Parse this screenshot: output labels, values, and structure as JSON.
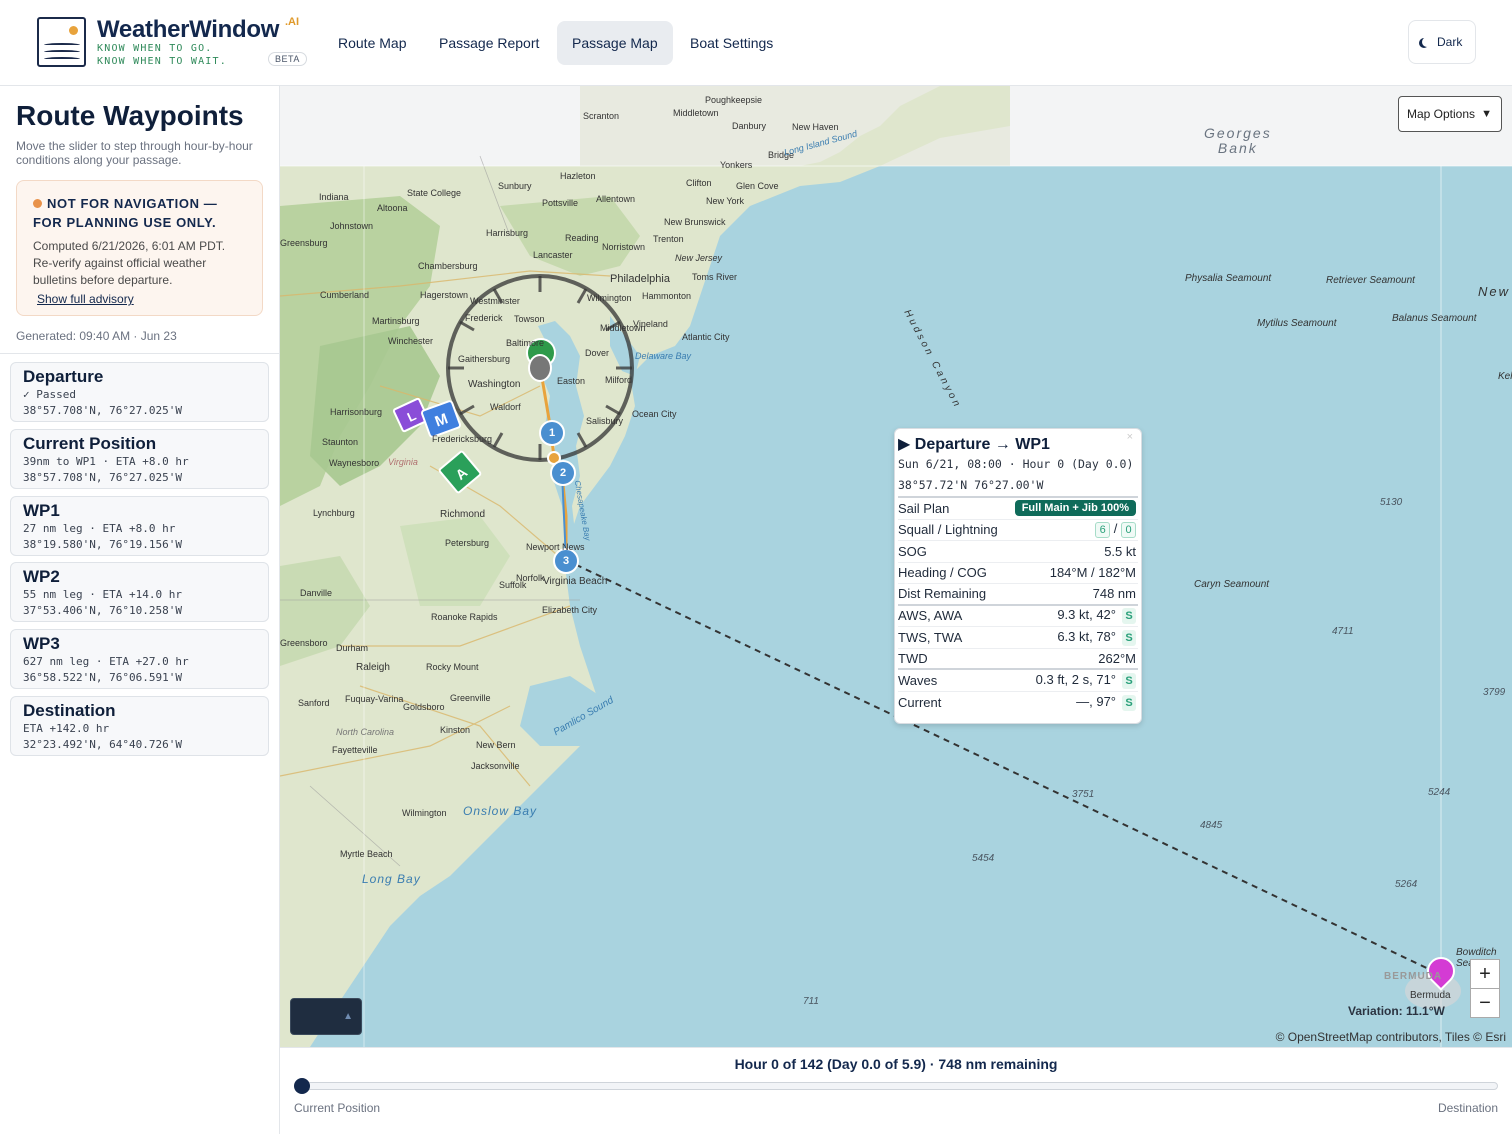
{
  "app": {
    "brand": "WeatherWindow",
    "brand_suffix": ".AI",
    "tagline_1": "KNOW WHEN TO GO.",
    "tagline_2": "KNOW WHEN TO WAIT.",
    "beta": "BETA"
  },
  "nav": {
    "items": [
      "Route Map",
      "Passage Report",
      "Passage Map",
      "Boat Settings"
    ],
    "active": "Passage Map",
    "theme_button": "Dark"
  },
  "sidebar": {
    "title": "Route Waypoints",
    "subtitle": "Move the slider to step through hour-by-hour conditions along your passage.",
    "advisory": {
      "heading_1": "NOT FOR NAVIGATION —",
      "heading_2": "FOR PLANNING USE ONLY.",
      "body_1": "Computed 6/21/2026, 6:01 AM PDT.",
      "body_2": "Re-verify against official weather",
      "body_3": "bulletins before departure.",
      "link": "Show full advisory",
      "accent": "#e8924a"
    },
    "generated": "Generated: 09:40 AM · Jun 23",
    "waypoints": [
      {
        "name": "Departure",
        "line1": "✓ Passed",
        "line2": "38°57.708'N, 76°27.025'W"
      },
      {
        "name": "Current Position",
        "line1": "39nm to WP1 · ETA +8.0 hr",
        "line2": "38°57.708'N, 76°27.025'W"
      },
      {
        "name": "WP1",
        "line1": "27 nm leg · ETA +8.0 hr",
        "line2": "38°19.580'N, 76°19.156'W"
      },
      {
        "name": "WP2",
        "line1": "55 nm leg · ETA +14.0 hr",
        "line2": "37°53.406'N, 76°10.258'W"
      },
      {
        "name": "WP3",
        "line1": "627 nm leg · ETA +27.0 hr",
        "line2": "36°58.522'N, 76°06.591'W"
      },
      {
        "name": "Destination",
        "line1": "ETA +142.0 hr",
        "line2": "32°23.492'N, 64°40.726'W"
      }
    ]
  },
  "map": {
    "options_label": "Map Options",
    "sea_labels": [
      "Georges",
      "Bank"
    ],
    "seamounts": [
      "Physalia Seamount",
      "Retriever Seamount",
      "Mytilus Seamount",
      "Balanus Seamount",
      "Caryn Seamount",
      "Bowditch Sea"
    ],
    "canyon": "Hudson Canyon",
    "new_label": "New",
    "ke_label": "Kel",
    "depths": [
      "5130",
      "4711",
      "3799",
      "5244",
      "3751",
      "4845",
      "5454",
      "5264",
      "711"
    ],
    "cities": [
      "Poughkeepsie",
      "Middletown",
      "Scranton",
      "Danbury",
      "New Haven",
      "Yonkers",
      "Bridge",
      "New York",
      "Long Island Sound",
      "Hazleton",
      "Clifton",
      "Glen Cove",
      "Allentown",
      "Sunbury",
      "State College",
      "Indiana",
      "Altoona",
      "Johnstown",
      "Pottsville",
      "New Brunswick",
      "Harrisburg",
      "Reading",
      "Norristown",
      "Trenton",
      "Greensburg",
      "Lancaster",
      "Philadelphia",
      "New Jersey",
      "Chambersburg",
      "Toms River",
      "Cumberland",
      "Hagerstown",
      "Westminster",
      "Wilmington",
      "Hammonton",
      "Martinsburg",
      "Frederick",
      "Towson",
      "Vineland",
      "Winchester",
      "Baltimore",
      "Middletown",
      "Atlantic City",
      "Gaithersburg",
      "Dover",
      "Delaware Bay",
      "Washington",
      "Easton",
      "Milford",
      "Harrisonburg",
      "Waldorf",
      "Salisbury",
      "Ocean City",
      "Staunton",
      "Fredericksburg",
      "Waynesboro",
      "Virginia",
      "Lynchburg",
      "Richmond",
      "Petersburg",
      "Newport News",
      "Danville",
      "Suffolk",
      "Norfolk",
      "Virginia Beach",
      "Elizabeth City",
      "Roanoke Rapids",
      "Durham",
      "Greensboro",
      "Raleigh",
      "Rocky Mount",
      "Greenville",
      "Sanford",
      "Fuquay-Varina",
      "Goldsboro",
      "Pamlico Sound",
      "North Carolina",
      "Kinston",
      "Fayetteville",
      "New Bern",
      "Jacksonville",
      "Onslow Bay",
      "Wilmington",
      "Myrtle Beach",
      "Long Bay",
      "Bermuda",
      "BERMUDA",
      "Chesapeake Bay"
    ],
    "markers": [
      "1",
      "2",
      "3"
    ],
    "wind_flags": [
      "M",
      "L",
      "A"
    ],
    "popup": {
      "title": "Departure → WP1",
      "close": "×",
      "time": "Sun 6/21, 08:00 · Hour 0  (Day 0.0)",
      "coords": "38°57.72'N 76°27.00'W",
      "rows": [
        {
          "label": "Sail Plan",
          "value": "Full Main + Jib 100%",
          "kind": "badge"
        },
        {
          "label": "Squall / Lightning",
          "value_a": "6",
          "value_b": "0",
          "kind": "squall"
        },
        {
          "label": "SOG",
          "value": "5.5 kt"
        },
        {
          "label": "Heading / COG",
          "value": "184°M / 182°M"
        },
        {
          "label": "Dist Remaining",
          "value": "748 nm",
          "thick": true
        },
        {
          "label": "AWS, AWA",
          "value": "9.3 kt, 42°",
          "badge": "S"
        },
        {
          "label": "TWS, TWA",
          "value": "6.3 kt, 78°",
          "badge": "S"
        },
        {
          "label": "TWD",
          "value": "262°M",
          "thick": true
        },
        {
          "label": "Waves",
          "value": "0.3 ft, 2 s, 71°",
          "badge": "S"
        },
        {
          "label": "Current",
          "value": "—, 97°",
          "badge": "S"
        }
      ]
    },
    "zoom_in": "+",
    "zoom_out": "−",
    "variation": "Variation: 11.1°W",
    "attribution": "© OpenStreetMap contributors, Tiles © Esri",
    "legend_toggle": "▲"
  },
  "timeline": {
    "status": "Hour 0 of 142 (Day 0.0 of 5.9) · 748 nm remaining",
    "current_hour": 0,
    "total_hours": 142,
    "left_label": "Current Position",
    "right_label": "Destination"
  },
  "colors": {
    "brand": "#13284d",
    "route": "#e8a33c",
    "marker": "#4a8fd0",
    "sail_badge": "#0f6b5a",
    "destination": "#d43bd4"
  }
}
